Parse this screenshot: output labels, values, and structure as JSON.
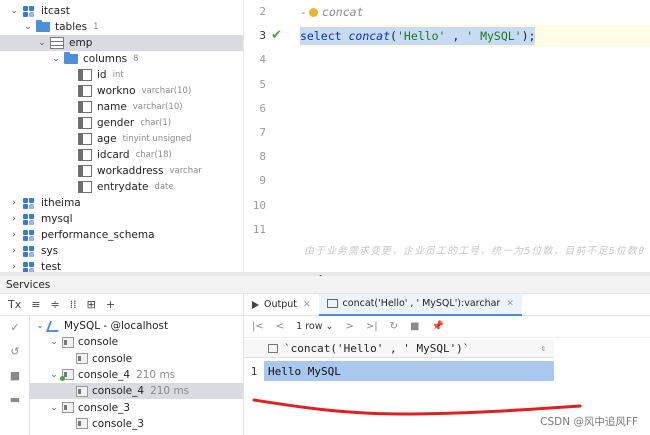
{
  "tree": {
    "items": [
      {
        "label": "itcast",
        "meta": "",
        "kind": "db",
        "indent": 1,
        "arrow": "⌄"
      },
      {
        "label": "tables",
        "meta": "1",
        "kind": "folder",
        "indent": 2,
        "arrow": "⌄"
      },
      {
        "label": "emp",
        "meta": "",
        "kind": "table",
        "indent": 3,
        "arrow": "⌄",
        "selected": true
      },
      {
        "label": "columns",
        "meta": "8",
        "kind": "folder",
        "indent": 4,
        "arrow": "⌄"
      },
      {
        "label": "id",
        "meta": "int",
        "kind": "col",
        "indent": 5,
        "arrow": ""
      },
      {
        "label": "workno",
        "meta": "varchar(10)",
        "kind": "col",
        "indent": 5,
        "arrow": ""
      },
      {
        "label": "name",
        "meta": "varchar(10)",
        "kind": "col",
        "indent": 5,
        "arrow": ""
      },
      {
        "label": "gender",
        "meta": "char(1)",
        "kind": "col",
        "indent": 5,
        "arrow": ""
      },
      {
        "label": "age",
        "meta": "tinyint unsigned",
        "kind": "col",
        "indent": 5,
        "arrow": ""
      },
      {
        "label": "idcard",
        "meta": "char(18)",
        "kind": "col",
        "indent": 5,
        "arrow": ""
      },
      {
        "label": "workaddress",
        "meta": "varchar",
        "kind": "col",
        "indent": 5,
        "arrow": ""
      },
      {
        "label": "entrydate",
        "meta": "date",
        "kind": "col",
        "indent": 5,
        "arrow": ""
      },
      {
        "label": "itheima",
        "meta": "",
        "kind": "db",
        "indent": 1,
        "arrow": "›"
      },
      {
        "label": "mysql",
        "meta": "",
        "kind": "db",
        "indent": 1,
        "arrow": "›"
      },
      {
        "label": "performance_schema",
        "meta": "",
        "kind": "db",
        "indent": 1,
        "arrow": "›"
      },
      {
        "label": "sys",
        "meta": "",
        "kind": "db",
        "indent": 1,
        "arrow": "›"
      },
      {
        "label": "test",
        "meta": "",
        "kind": "db",
        "indent": 1,
        "arrow": "›"
      }
    ]
  },
  "editor": {
    "line_numbers": [
      "2",
      "3",
      "4",
      "5",
      "6",
      "7",
      "8",
      "9",
      "10",
      "11"
    ],
    "comment_prefix": "-",
    "comment": "concat",
    "code": {
      "kw_select": "select",
      "fn": "concat",
      "open": "(",
      "arg1": "'Hello'",
      "comma": " , ",
      "arg2": "' MySQL'",
      "close": ");"
    },
    "faded_text": "由于业务需求变更，企业员工的工号，统一为5位数，目前不足5位数的全部在前面补0"
  },
  "services": {
    "title": "Services",
    "toolbar": [
      "Tx",
      "≡",
      "≑",
      "⁞⁞",
      "⊞",
      "+"
    ],
    "side_icons": [
      "✓",
      "↺",
      "■",
      "▬"
    ],
    "tree": [
      {
        "label": "MySQL - @localhost",
        "time": "",
        "kind": "host",
        "indent": 0,
        "arrow": "⌄"
      },
      {
        "label": "console",
        "time": "",
        "kind": "console",
        "indent": 1,
        "arrow": "⌄"
      },
      {
        "label": "console",
        "time": "",
        "kind": "console",
        "indent": 2,
        "arrow": ""
      },
      {
        "label": "console_4",
        "time": "210 ms",
        "kind": "console",
        "indent": 1,
        "arrow": "⌄",
        "green": true
      },
      {
        "label": "console_4",
        "time": "210 ms",
        "kind": "console",
        "indent": 2,
        "arrow": "",
        "selected": true
      },
      {
        "label": "console_3",
        "time": "",
        "kind": "console",
        "indent": 1,
        "arrow": "⌄"
      },
      {
        "label": "console_3",
        "time": "",
        "kind": "console",
        "indent": 2,
        "arrow": ""
      }
    ]
  },
  "output": {
    "tabs": [
      {
        "label": "Output",
        "active": false
      },
      {
        "label": "concat('Hello' , ' MySQL'):varchar",
        "active": true
      }
    ],
    "nav": {
      "first": "|<",
      "prev": "<",
      "rows": "1 row ⌄",
      "next": ">",
      "last": ">|",
      "refresh": "↻",
      "stop": "■",
      "pin": "📌"
    },
    "column_header": "`concat('Hello' , ' MySQL')`",
    "sort_icon": "⇕",
    "row_number": "1",
    "row_value": "Hello MySQL"
  },
  "watermark": "CSDN @风中追风FF",
  "colors": {
    "selection": "#c8dbf5",
    "keyword": "#0a30b3",
    "string": "#1b7a1b",
    "annotation": "#e02020"
  }
}
